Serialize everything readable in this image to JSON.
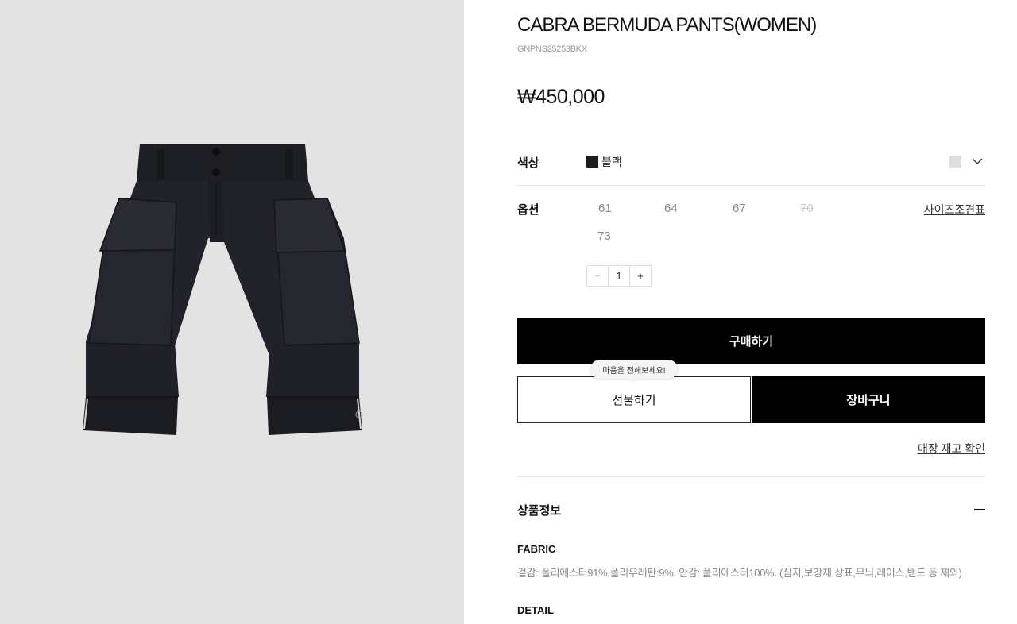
{
  "product": {
    "name": "CABRA BERMUDA PANTS(WOMEN)",
    "code": "GNPNS25253BKX",
    "price": "₩450,000"
  },
  "color": {
    "label": "색상",
    "selected": "블랙",
    "swatch_color": "#1c1c1c"
  },
  "options": {
    "label": "옵션",
    "sizes": [
      {
        "value": "61",
        "available": true
      },
      {
        "value": "64",
        "available": true
      },
      {
        "value": "67",
        "available": true
      },
      {
        "value": "70",
        "available": false
      },
      {
        "value": "73",
        "available": true
      }
    ],
    "size_chart": "사이즈조견표"
  },
  "quantity": {
    "minus": "−",
    "value": "1",
    "plus": "+"
  },
  "buttons": {
    "buy": "구매하기",
    "gift": "선물하기",
    "cart": "장바구니",
    "gift_tooltip": "마음을 전해보세요!"
  },
  "store_stock": "매장 재고 확인",
  "details": {
    "section_title": "상품정보",
    "fabric_heading": "FABRIC",
    "fabric_text": "겉감: 폴리에스터91%,폴리우레탄:9%. 안감: 폴리에스터100%. (심지,보강재,상표,무늬,레이스,밴드 등 제외)",
    "detail_heading": "DETAIL"
  },
  "icons": {
    "color_dropdown": "chevron-down-icon",
    "collapse": "minus-icon"
  }
}
